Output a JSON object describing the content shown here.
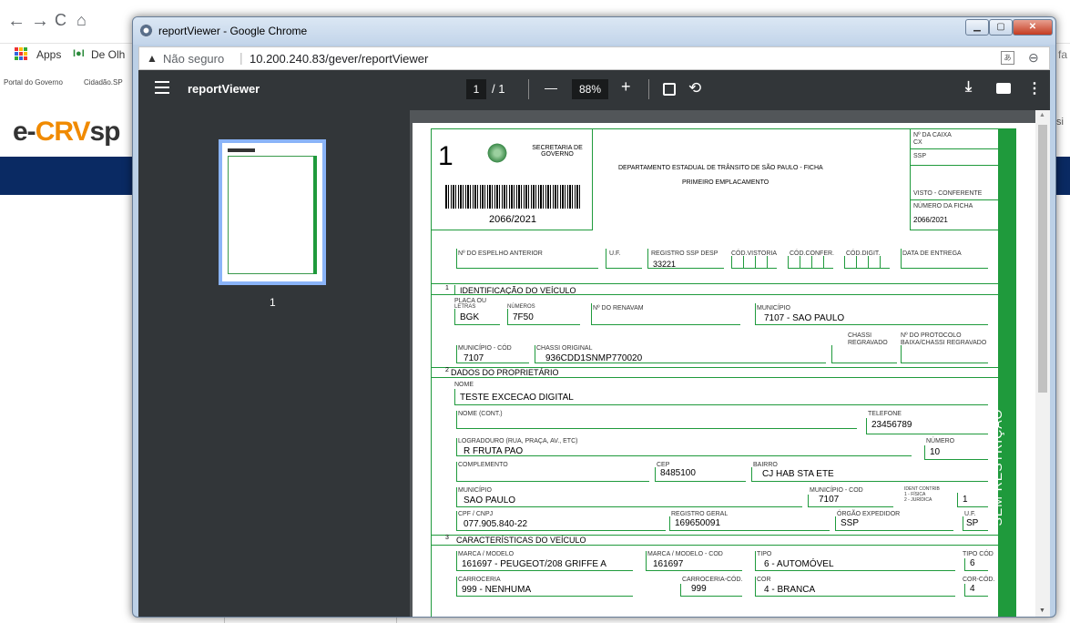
{
  "background": {
    "bookmarks": {
      "apps": "Apps",
      "deolho": "De Olh",
      "right_fragment": "fa"
    },
    "links": {
      "portal": "Portal do Governo",
      "cidadao": "Cidadão.SP"
    },
    "logo": {
      "prefix": "e-",
      "crv": "CRV",
      "sp": "sp"
    },
    "right_edge_text": "si"
  },
  "window": {
    "title": "reportViewer - Google Chrome",
    "address": {
      "security": "Não seguro",
      "url": "10.200.240.83/gever/reportViewer"
    }
  },
  "pdf_toolbar": {
    "title": "reportViewer",
    "current_page": "1",
    "page_separator": "/ 1",
    "zoom": "88%",
    "minus": "—",
    "plus": "+"
  },
  "thumbnail": {
    "page_number": "1"
  },
  "form": {
    "header": {
      "number": "1",
      "secretaria": "SECRETARIA DE GOVERNO",
      "departamento": "DEPARTAMENTO ESTADUAL DE TRÂNSITO DE SÃO PAULO - FICHA",
      "primeiro": "PRIMEIRO EMPLACAMENTO",
      "barcode_number": "2066/2021",
      "caixa_label": "Nº DA CAIXA",
      "caixa_value": "CX",
      "ssp_label": "SSP",
      "visto": "VISTO - CONFERENTE",
      "numero_ficha_label": "NÚMERO DA FICHA",
      "numero_ficha": "2066/2021",
      "side_stamp": "SEM RESTRIÇÃO"
    },
    "top_row": {
      "espelho_label": "Nº DO ESPELHO ANTERIOR",
      "uf_label": "U.F.",
      "registro_label": "REGISTRO SSP DESP",
      "registro_value": "33221",
      "vistoria_label": "CÓD.VISTORIA",
      "confer_label": "CÓD.CONFER.",
      "digit_label": "CÓD.DIGIT.",
      "data_label": "DATA DE ENTREGA"
    },
    "sec1": {
      "num": "1",
      "title": "IDENTIFICAÇÃO DO VEÍCULO",
      "placa_label": "PLACA OU",
      "letras_label": "LETRAS",
      "letras": "BGK",
      "numeros_label": "NÚMEROS",
      "numeros": "7F50",
      "renavam_label": "Nº DO RENAVAM",
      "municipio_label": "MUNICÍPIO",
      "municipio": "7107 - SAO PAULO",
      "chassi_label": "CHASSI",
      "regravado_label": "REGRAVADO",
      "protocolo_label": "Nº DO PROTOCOLO",
      "baixa_label": "BAIXA/CHASSI REGRAVADO",
      "mun_cod_label": "MUNICÍPIO - CÓD",
      "mun_cod": "7107",
      "chassi_orig_label": "CHASSI ORIGINAL",
      "chassi_orig": "936CDD1SNMP770020"
    },
    "sec2": {
      "num": "2",
      "title": "DADOS DO PROPRIETÁRIO",
      "nome_label": "NOME",
      "nome": "TESTE EXCECAO DIGITAL",
      "nome_cont_label": "NOME (CONT.)",
      "telefone_label": "TELEFONE",
      "telefone": "23456789",
      "logradouro_label": "LOGRADOURO (RUA, PRAÇA, AV., ETC)",
      "logradouro": "R FRUTA PAO",
      "numero_label": "NÚMERO",
      "numero": "10",
      "complemento_label": "COMPLEMENTO",
      "cep_label": "CEP",
      "cep": "8485100",
      "bairro_label": "BAIRRO",
      "bairro": "CJ HAB STA ETE",
      "municipio_label": "MUNICÍPIO",
      "municipio": "SAO PAULO",
      "mun_cod_label": "MUNICÍPIO - COD",
      "mun_cod": "7107",
      "ident_label": "IDENT CONTRIB",
      "fisica_label": "1 - FÍSICA",
      "juridica_label": "2 - JURÍDICA",
      "ident": "1",
      "cpf_label": "CPF / CNPJ",
      "cpf": "077.905.840-22",
      "rg_label": "REGISTRO GERAL",
      "rg": "169650091",
      "orgao_label": "ÓRGÃO EXPEDIDOR",
      "orgao": "SSP",
      "uf_label": "U.F.",
      "uf": "SP"
    },
    "sec3": {
      "num": "3",
      "title": "CARACTERÍSTICAS DO VEÍCULO",
      "marca_label": "MARCA / MODELO",
      "marca": "161697 - PEUGEOT/208 GRIFFE A",
      "marca_cod_label": "MARCA / MODELO - COD",
      "marca_cod": "161697",
      "tipo_label": "TIPO",
      "tipo": "6 - AUTOMÓVEL",
      "tipo_cod_label": "TIPO CÓD",
      "tipo_cod": "6",
      "carroceria_label": "CARROCERIA",
      "carroceria": "999 - NENHUMA",
      "carroceria_cod_label": "CARROCERIA-CÓD.",
      "carroceria_cod": "999",
      "cor_label": "COR",
      "cor": "4 - BRANCA",
      "cor_cod_label": "COR-CÓD.",
      "cor_cod": "4"
    }
  }
}
